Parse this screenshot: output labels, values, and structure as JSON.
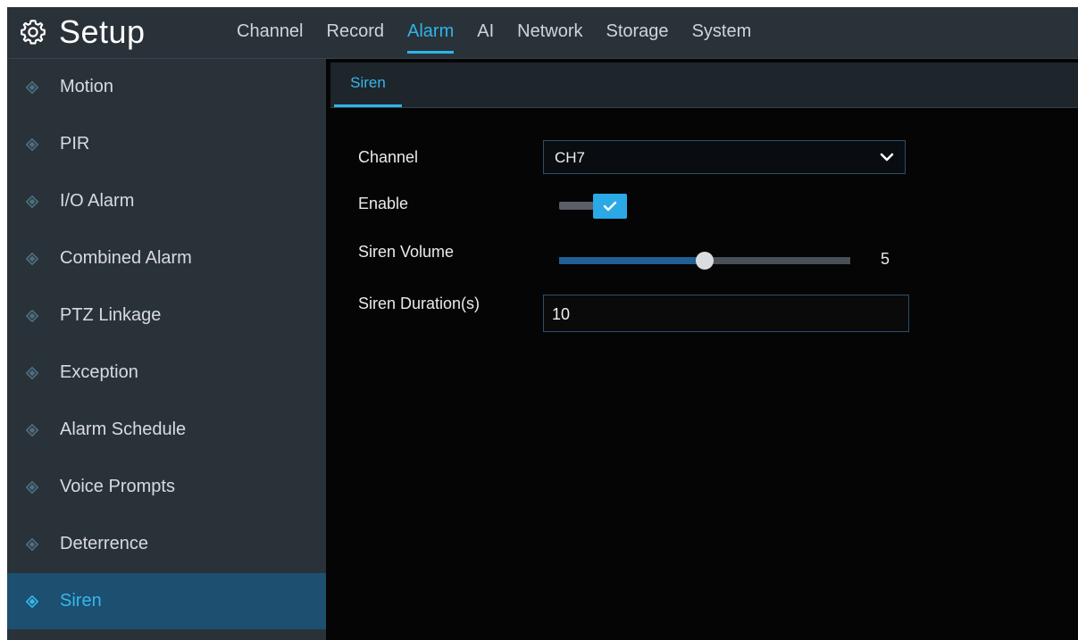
{
  "app": {
    "title": "Setup",
    "icon": "gear-icon"
  },
  "nav": {
    "tabs": [
      {
        "label": "Channel",
        "active": false
      },
      {
        "label": "Record",
        "active": false
      },
      {
        "label": "Alarm",
        "active": true
      },
      {
        "label": "AI",
        "active": false
      },
      {
        "label": "Network",
        "active": false
      },
      {
        "label": "Storage",
        "active": false
      },
      {
        "label": "System",
        "active": false
      }
    ]
  },
  "sidebar": {
    "items": [
      {
        "label": "Motion",
        "active": false
      },
      {
        "label": "PIR",
        "active": false
      },
      {
        "label": "I/O Alarm",
        "active": false
      },
      {
        "label": "Combined Alarm",
        "active": false
      },
      {
        "label": "PTZ Linkage",
        "active": false
      },
      {
        "label": "Exception",
        "active": false
      },
      {
        "label": "Alarm Schedule",
        "active": false
      },
      {
        "label": "Voice Prompts",
        "active": false
      },
      {
        "label": "Deterrence",
        "active": false
      },
      {
        "label": "Siren",
        "active": true
      }
    ]
  },
  "main": {
    "subtab": "Siren",
    "form": {
      "channel": {
        "label": "Channel",
        "value": "CH7"
      },
      "enable": {
        "label": "Enable",
        "checked": true
      },
      "volume": {
        "label": "Siren Volume",
        "value": "5",
        "level": 0.5
      },
      "duration": {
        "label": "Siren Duration(s)",
        "value": "10"
      }
    }
  },
  "colors": {
    "accent": "#2fb4ea",
    "panel": "#2a3239",
    "sidebar_active": "#1c4f70",
    "background": "#050505"
  }
}
